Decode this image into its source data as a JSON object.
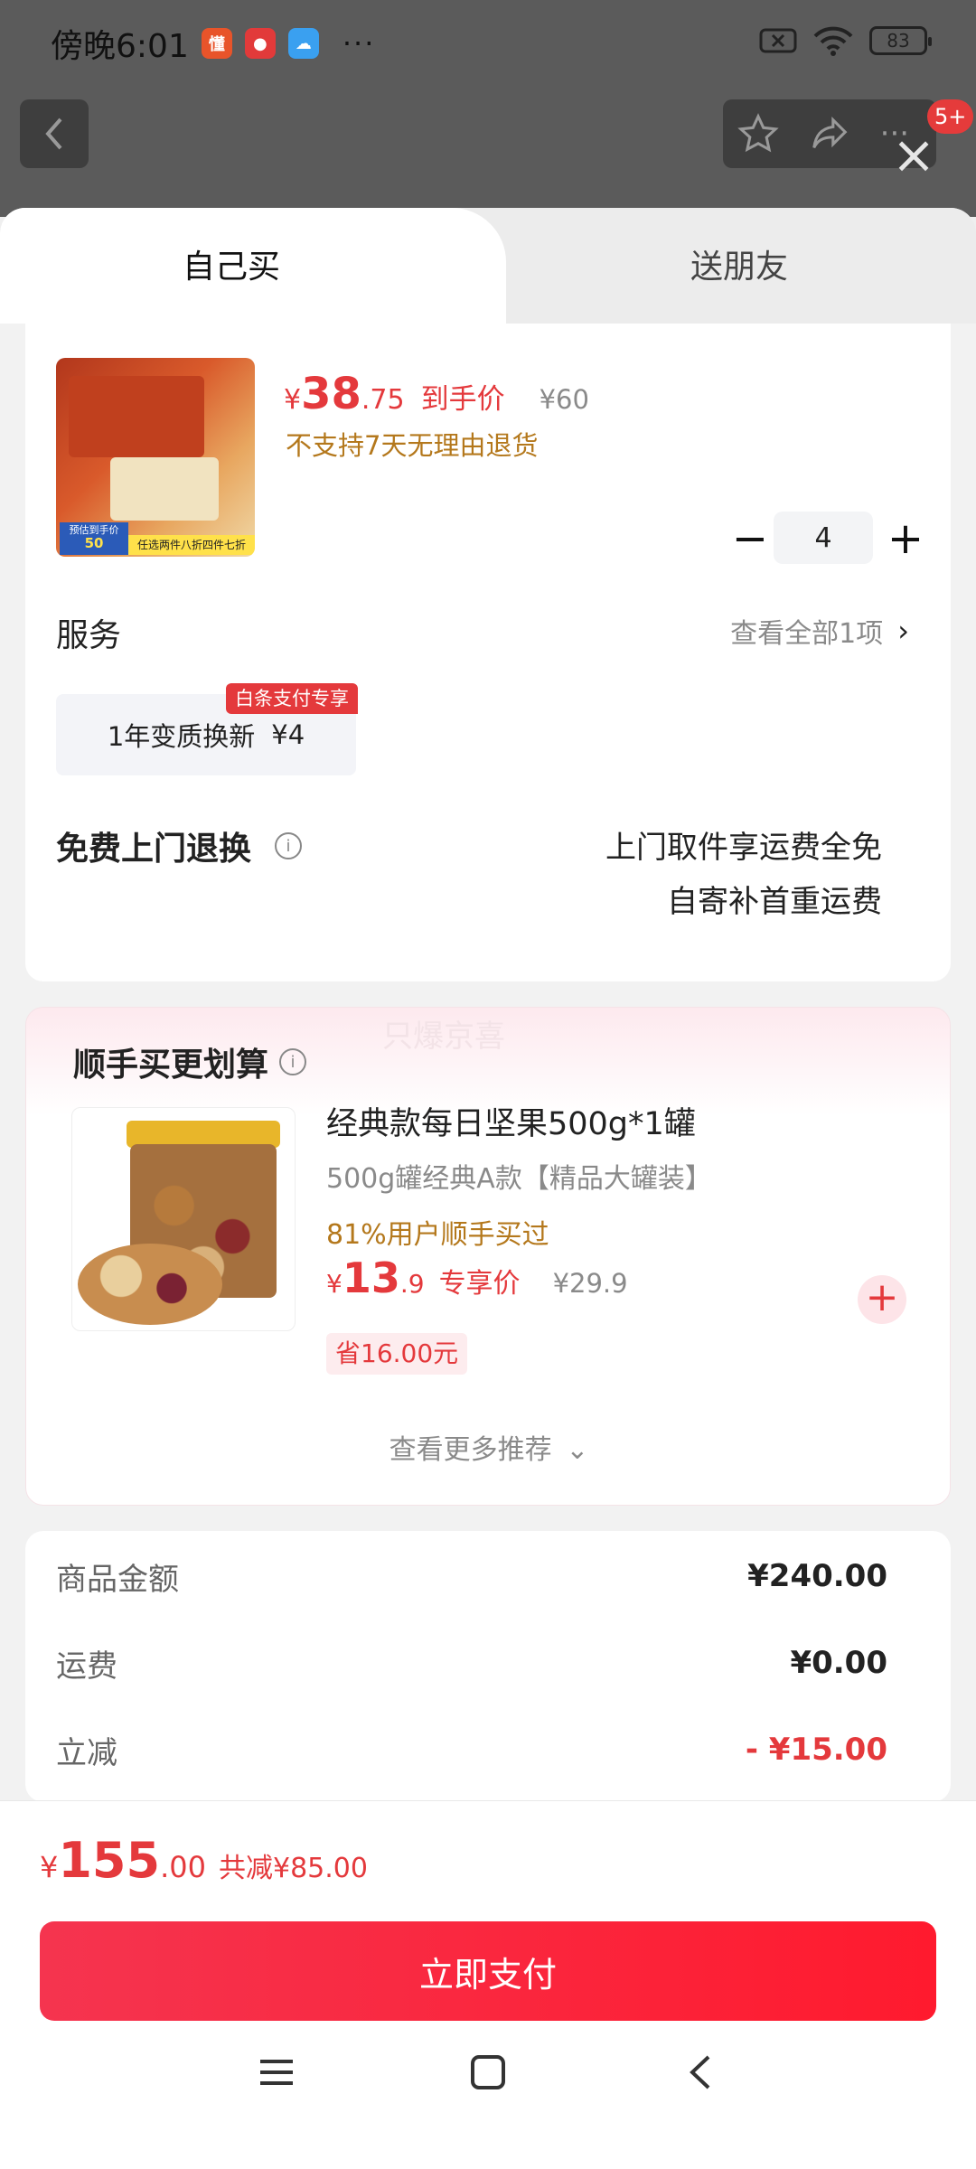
{
  "status": {
    "time": "傍晚6:01",
    "battery": "83",
    "more": "···"
  },
  "header": {
    "badge": "5+"
  },
  "tabs": {
    "self_buy": "自己买",
    "gift": "送朋友"
  },
  "product": {
    "price_symbol": "¥",
    "price_int": "38",
    "price_dec": ".75",
    "price_tag": "到手价",
    "original_price": "¥60",
    "return_policy": "不支持7天无理由退货",
    "quantity": "4",
    "image_promo_price_label": "预估到手价",
    "image_promo_price": "50",
    "image_promo_text": "任选两件八折四件七折"
  },
  "service": {
    "title": "服务",
    "see_all": "查看全部1项",
    "option_label": "1年变质换新",
    "option_price": "¥4",
    "option_badge": "白条支付专享"
  },
  "free_return": {
    "title": "免费上门退换",
    "line1": "上门取件享运费全免",
    "line2": "自寄补首重运费"
  },
  "addon": {
    "section_title": "顺手买更划算",
    "watermark": "只爆京喜",
    "product_name": "经典款每日坚果500g*1罐",
    "spec": "500g罐经典A款【精品大罐装】",
    "popularity": "81%用户顺手买过",
    "price_symbol": "¥",
    "price_int": "13",
    "price_dec": ".9",
    "price_tag": "专享价",
    "original_price": "¥29.9",
    "save_tag": "省16.00元",
    "see_more": "查看更多推荐"
  },
  "summary": {
    "goods_label": "商品金额",
    "goods_value": "¥240.00",
    "shipping_label": "运费",
    "shipping_value": "¥0.00",
    "discount_label": "立减",
    "discount_value": "- ¥15.00"
  },
  "footer": {
    "total_symbol": "¥",
    "total_int": "155",
    "total_dec": ".00",
    "total_saved": "共减¥85.00",
    "pay_button": "立即支付"
  },
  "colors": {
    "accent_red": "#e4393c",
    "orange_text": "#b4781c",
    "pay_gradient_start": "#f5344f",
    "pay_gradient_end": "#ff1a2e"
  }
}
